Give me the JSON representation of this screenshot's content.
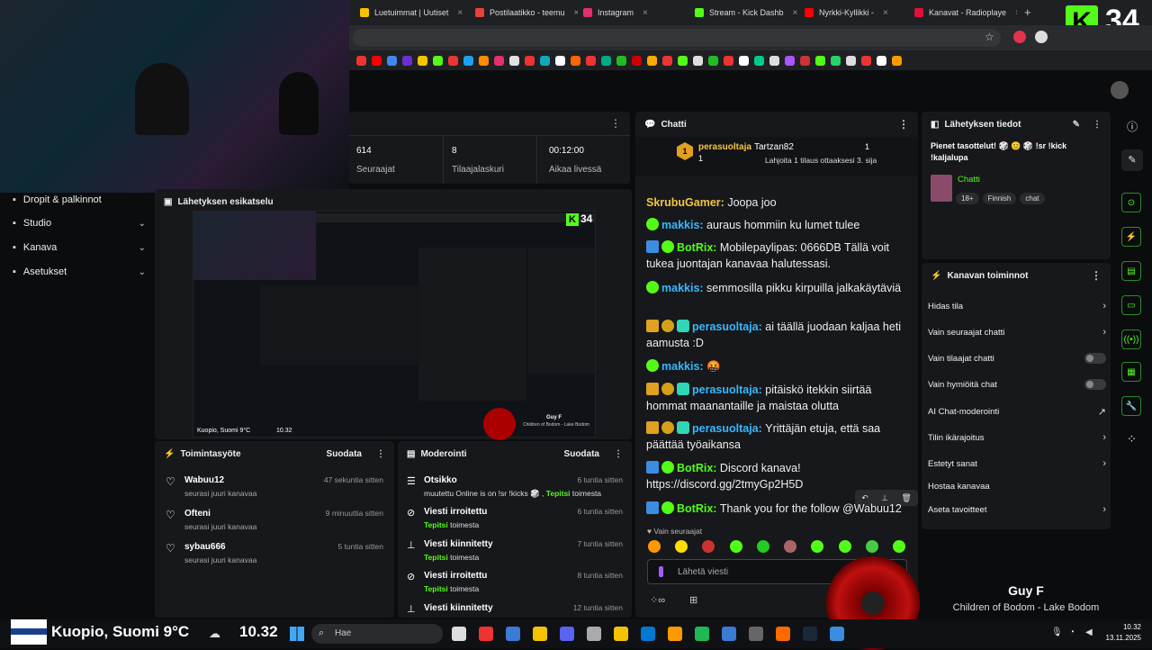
{
  "browser": {
    "tabs": [
      {
        "label": "Luetuimmat | Uutiset",
        "color": "#f5c400"
      },
      {
        "label": "Postilaatikko - teemu",
        "color": "#ea4335"
      },
      {
        "label": "Instagram",
        "color": "#e1306c"
      },
      {
        "label": "Stream - Kick Dashb",
        "color": "#53fc18"
      },
      {
        "label": "Nyrkki-Kyllikki - ",
        "color": "#ff0000"
      },
      {
        "label": "Kanavat - Radioplaye",
        "color": "#e0103a"
      }
    ],
    "new_tab": "+",
    "kick_counter": "34"
  },
  "webcam_overlay": {
    "desc_icon": "webcam"
  },
  "sidebar": {
    "items": [
      {
        "label": "Dropit & palkinnot",
        "icon": "gift-icon",
        "chev": ""
      },
      {
        "label": "Studio",
        "icon": "studio-icon",
        "chev": "⌄"
      },
      {
        "label": "Kanava",
        "icon": "channel-icon",
        "chev": "⌄"
      },
      {
        "label": "Asetukset",
        "icon": "settings-icon",
        "chev": "⌄"
      }
    ]
  },
  "stats": [
    {
      "num": "614",
      "label": "Seuraajat"
    },
    {
      "num": "8",
      "label": "Tilaajalaskuri"
    },
    {
      "num": "00:12:00",
      "label": "Aikaa livessä"
    }
  ],
  "preview": {
    "title": "Lähetyksen esikatselu",
    "location": "Kuopio, Suomi 9°C",
    "time": "10.32",
    "song": "Guy F",
    "artist": "Children of Bodom - Lake Bodom",
    "counter": "34"
  },
  "activity": {
    "title": "Toimintasyöte",
    "filter": "Suodata",
    "rows": [
      {
        "name": "Wabuu12",
        "sub": "seurasi juuri kanavaa",
        "time": "47 sekuntia sitten"
      },
      {
        "name": "Ofteni",
        "sub": "seurasi juuri kanavaa",
        "time": "9 minuuttia sitten"
      },
      {
        "name": "sybau666",
        "sub": "seurasi juuri kanavaa",
        "time": "5 tuntia sitten"
      }
    ]
  },
  "moderation": {
    "title": "Moderointi",
    "filter": "Suodata",
    "rows": [
      {
        "name": "Otsikko",
        "sub": "muutettu Online is on !sr !kicks 🎲 , Tepitsi toimesta",
        "time": "6 tuntia sitten",
        "icon": "edit-title-icon"
      },
      {
        "name": "Viesti irroitettu",
        "sub": "Tepitsi toimesta",
        "time": "6 tuntia sitten",
        "icon": "unpin-icon"
      },
      {
        "name": "Viesti kiinnitetty",
        "sub": "Tepitsi toimesta",
        "time": "7 tuntia sitten",
        "icon": "pin-icon"
      },
      {
        "name": "Viesti irroitettu",
        "sub": "Tepitsi toimesta",
        "time": "8 tuntia sitten",
        "icon": "unpin-icon"
      },
      {
        "name": "Viesti kiinnitetty",
        "sub": "",
        "time": "12 tuntia sitten",
        "icon": "pin-icon"
      }
    ]
  },
  "chat": {
    "title": "Chatti",
    "top_gifter": "perasuoltaja",
    "top_gifter_count": "1",
    "gift_user": "Tartzan82",
    "gift_count": "1",
    "gift_note": "Lahjoita 1 tilaus ottaaksesi 3. sija",
    "messages": [
      {
        "user": "SkrubuGamer",
        "cls": "u-gold",
        "badges": [],
        "text": "Joopa joo"
      },
      {
        "user": "makkis",
        "cls": "u-blue",
        "badges": [
          "b-verified"
        ],
        "text": "auraus hommiin ku lumet tulee"
      },
      {
        "user": "BotRix",
        "cls": "u-botrix",
        "badges": [
          "b-bot",
          "b-verified"
        ],
        "text": "Mobilepaylipas: 0666DB Tällä voit tukea juontajan kanavaa halutessasi."
      },
      {
        "user": "makkis",
        "cls": "u-blue",
        "badges": [
          "b-verified"
        ],
        "text": "semmosilla pikku kirpuilla jalkakäytäviä"
      },
      {
        "user": "perasuoltaja",
        "cls": "u-blue",
        "badges": [
          "b-crown",
          "b-one",
          "b-sub"
        ],
        "text": "ai täällä juodaan kaljaa heti aamusta :D"
      },
      {
        "user": "makkis",
        "cls": "u-blue",
        "badges": [
          "b-verified"
        ],
        "text": "🤬"
      },
      {
        "user": "perasuoltaja",
        "cls": "u-blue",
        "badges": [
          "b-crown",
          "b-one",
          "b-sub"
        ],
        "text": "pitäiskö itekkin siirtää hommat maanantaille ja maistaa olutta"
      },
      {
        "user": "perasuoltaja",
        "cls": "u-blue",
        "badges": [
          "b-crown",
          "b-one",
          "b-sub"
        ],
        "text": "Yrittäjän etuja, että saa päättää työaikansa"
      },
      {
        "user": "BotRix",
        "cls": "u-botrix",
        "badges": [
          "b-bot",
          "b-verified"
        ],
        "text": "Discord kanava! https://discord.gg/2tmyGp2H5D"
      },
      {
        "user": "BotRix",
        "cls": "u-botrix",
        "badges": [
          "b-bot",
          "b-verified"
        ],
        "text": "Thank you for the follow @Wabuu12"
      }
    ],
    "followers_only": "Vain seuraajat",
    "input_placeholder": "Lähetä viesti"
  },
  "stream_info": {
    "title": "Lähetyksen tiedot",
    "stream_title": "Pienet tasottelut! 🎲 😊 🎲 !sr !kick !kaljalupa",
    "category": "Chatti",
    "tags": [
      "18+",
      "Finnish",
      "chat"
    ]
  },
  "channel_actions": {
    "title": "Kanavan toiminnot",
    "items": [
      {
        "label": "Hidas tila",
        "kind": "chev"
      },
      {
        "label": "Vain seuraajat chatti",
        "kind": "chev"
      },
      {
        "label": "Vain tilaajat chatti",
        "kind": "toggle"
      },
      {
        "label": "Vain hymiöitä chat",
        "kind": "toggle"
      },
      {
        "label": "AI Chat-moderointi",
        "kind": "ext"
      },
      {
        "label": "Tilin ikärajoitus",
        "kind": "chev"
      },
      {
        "label": "Estetyt sanat",
        "kind": "chev"
      },
      {
        "label": "Hostaa kanavaa",
        "kind": "none"
      },
      {
        "label": "Aseta tavoitteet",
        "kind": "chev"
      }
    ]
  },
  "now_playing": {
    "song": "Guy F",
    "artist": "Children of Bodom - Lake Bodom"
  },
  "taskbar": {
    "location": "Kuopio, Suomi 9°C",
    "time": "10.32",
    "search_placeholder": "Hae",
    "clock_time": "10.32",
    "clock_date": "13.11.2025"
  }
}
